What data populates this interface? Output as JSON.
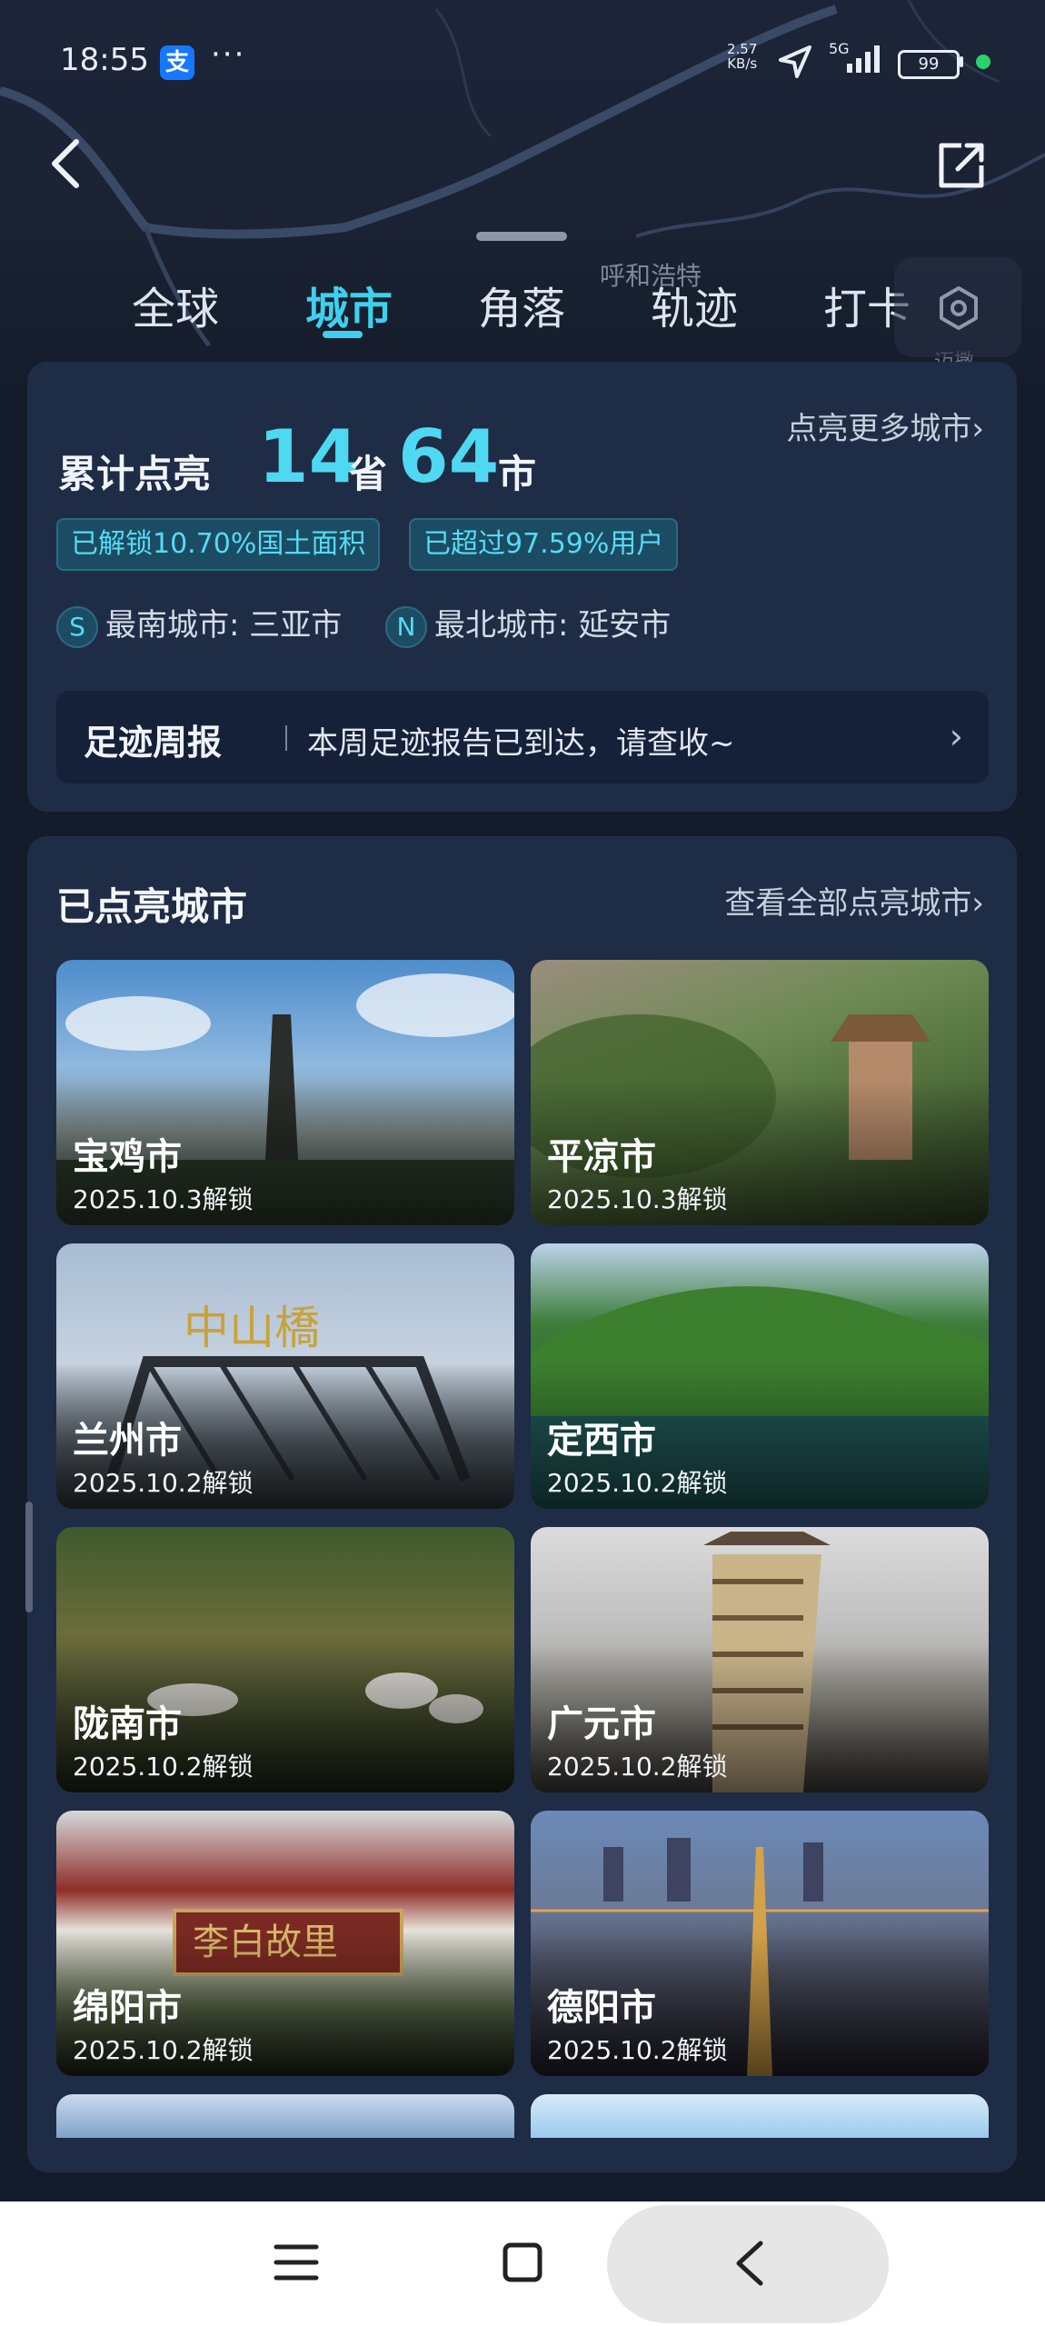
{
  "status_bar": {
    "time": "18:55",
    "app_badge": "支",
    "more": "···",
    "net_speed_value": "2.57",
    "net_speed_unit": "KB/s",
    "network": "5G",
    "battery": "99"
  },
  "map": {
    "label_city": "呼和浩特",
    "label_partial": "迈撒"
  },
  "tabs": [
    {
      "label": "全球"
    },
    {
      "label": "城市"
    },
    {
      "label": "角落"
    },
    {
      "label": "轨迹"
    },
    {
      "label": "打卡"
    }
  ],
  "active_tab": "城市",
  "summary": {
    "prefix": "累计点亮",
    "province_count": "14",
    "province_unit": "省",
    "city_count": "64",
    "city_unit": "市",
    "more_link": "点亮更多城市",
    "pill_area": "已解锁10.70%国土面积",
    "pill_users": "已超过97.59%用户",
    "south_badge": "S",
    "south_text": "最南城市: 三亚市",
    "north_badge": "N",
    "north_text": "最北城市: 延安市",
    "weekly_title": "足迹周报",
    "weekly_text": "本周足迹报告已到达，请查收~"
  },
  "lit_cities": {
    "title": "已点亮城市",
    "more_link": "查看全部点亮城市",
    "items": [
      {
        "name": "宝鸡市",
        "date": "2025.10.3解锁"
      },
      {
        "name": "平凉市",
        "date": "2025.10.3解锁"
      },
      {
        "name": "兰州市",
        "date": "2025.10.2解锁"
      },
      {
        "name": "定西市",
        "date": "2025.10.2解锁"
      },
      {
        "name": "陇南市",
        "date": "2025.10.2解锁"
      },
      {
        "name": "广元市",
        "date": "2025.10.2解锁"
      },
      {
        "name": "绵阳市",
        "date": "2025.10.2解锁"
      },
      {
        "name": "德阳市",
        "date": "2025.10.2解锁"
      }
    ]
  },
  "icons": {
    "accent": "#3fd0ee",
    "back": "chevron-left-icon",
    "share": "external-link-icon",
    "settings": "settings-hexagon-icon"
  }
}
